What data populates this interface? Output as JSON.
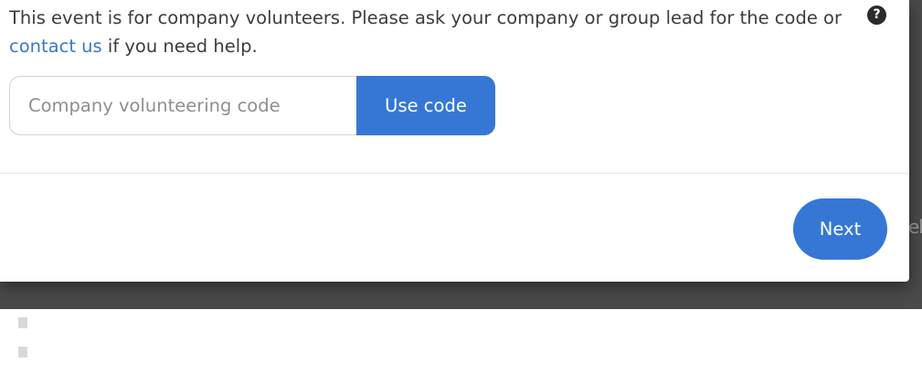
{
  "notice": {
    "text_before": "This event is for company volunteers. Please ask your company or group lead for the code or ",
    "link_text": "contact us",
    "text_after": " if you need help."
  },
  "help_icon": {
    "glyph": "?",
    "icon": "question-circle-icon"
  },
  "code_form": {
    "placeholder": "Company volunteering code",
    "value": "",
    "submit_label": "Use code"
  },
  "footer": {
    "next_label": "Next"
  },
  "background": {
    "partial_text": "el"
  },
  "colors": {
    "primary": "#3677d6",
    "link": "#3a78c9",
    "text": "#3c3c3c",
    "backdrop": "#4a4a4a"
  }
}
